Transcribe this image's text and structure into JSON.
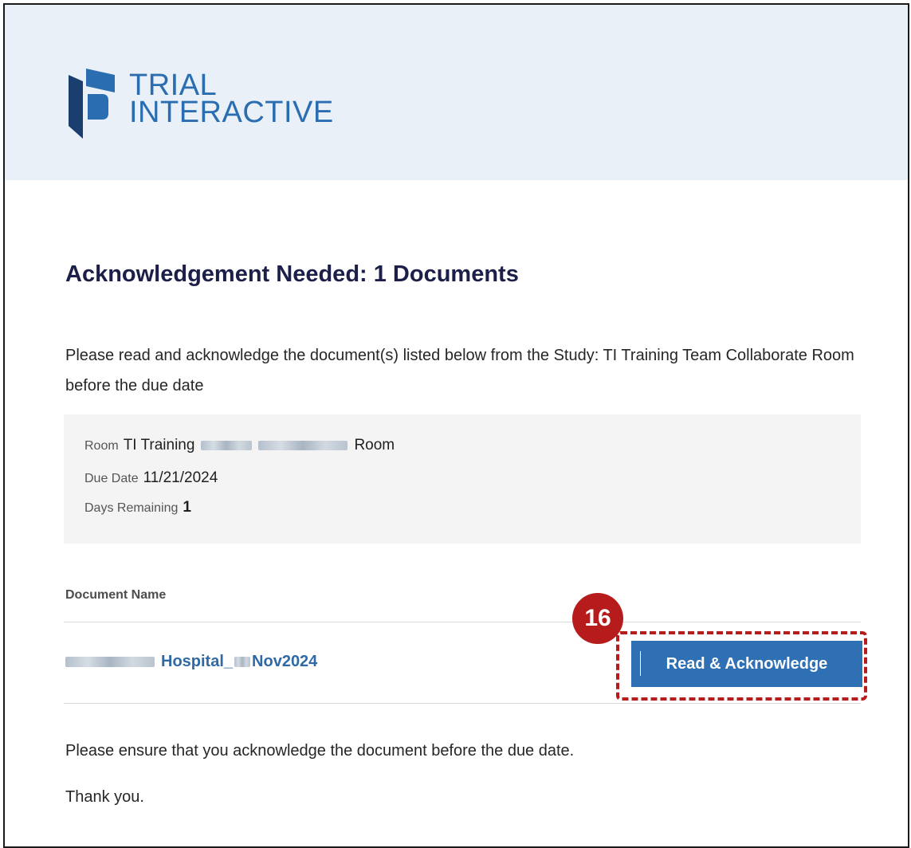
{
  "brand": {
    "line1": "TRIAL",
    "line2": "INTERACTIVE",
    "colors": {
      "dark": "#1a3e6e",
      "light": "#2a6db0"
    }
  },
  "email": {
    "title": "Acknowledgement Needed: 1 Documents",
    "intro": "Please read and acknowledge the document(s) listed below from the Study: TI Training Team Collaborate Room before the due date",
    "info": {
      "room_label": "Room",
      "room_value_start": "TI Training",
      "room_value_end": "Room",
      "due_date_label": "Due Date",
      "due_date_value": "11/21/2024",
      "days_remaining_label": "Days Remaining",
      "days_remaining_value": "1"
    },
    "documents_header": "Document Name",
    "document": {
      "name_part1": "Hospital_",
      "name_part2": "Nov2024"
    },
    "acknowledge_button": "Read & Acknowledge",
    "ensure_note": "Please ensure that you acknowledge the document before the due date.",
    "thanks": "Thank you."
  },
  "annotation": {
    "step_number": "16",
    "color": "#b71c1c"
  },
  "theme": {
    "header_bg": "#e9f0f7",
    "title_color": "#1c1f47",
    "link_color": "#2f6aa6",
    "button_color": "#2f6fb3"
  }
}
